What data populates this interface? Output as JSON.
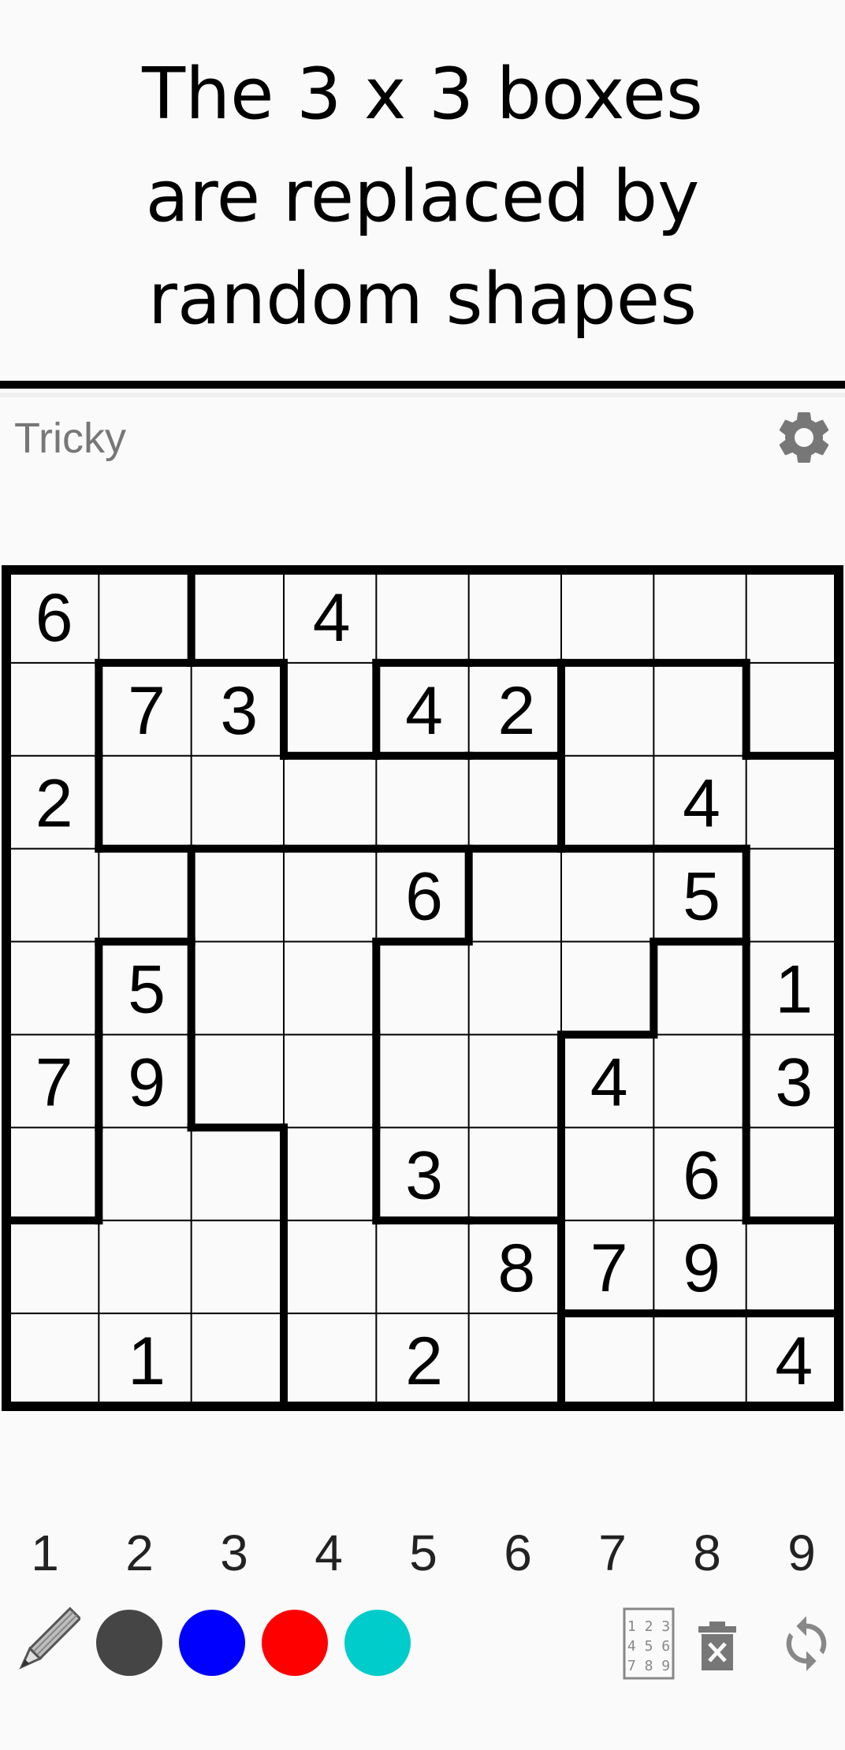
{
  "banner": {
    "lines": [
      "The 3 x 3 boxes",
      "are replaced by",
      "random shapes"
    ]
  },
  "header": {
    "difficulty": "Tricky",
    "settings_icon": "gear-icon"
  },
  "board": {
    "size": 9,
    "givens": [
      [
        "6",
        "",
        "",
        "4",
        "",
        "",
        "",
        "",
        ""
      ],
      [
        "",
        "7",
        "3",
        "",
        "4",
        "2",
        "",
        "",
        ""
      ],
      [
        "2",
        "",
        "",
        "",
        "",
        "",
        "",
        "4",
        ""
      ],
      [
        "",
        "",
        "",
        "",
        "6",
        "",
        "",
        "5",
        ""
      ],
      [
        "",
        "5",
        "",
        "",
        "",
        "",
        "",
        "",
        "1"
      ],
      [
        "7",
        "9",
        "",
        "",
        "",
        "",
        "4",
        "",
        "3"
      ],
      [
        "",
        "",
        "",
        "",
        "3",
        "",
        "",
        "6",
        ""
      ],
      [
        "",
        "",
        "",
        "",
        "",
        "8",
        "7",
        "9",
        ""
      ],
      [
        "",
        "1",
        "",
        "",
        "2",
        "",
        "",
        "",
        "4"
      ]
    ],
    "regions": [
      [
        0,
        0,
        1,
        1,
        1,
        1,
        1,
        1,
        1
      ],
      [
        0,
        2,
        2,
        1,
        3,
        3,
        4,
        4,
        1
      ],
      [
        0,
        2,
        2,
        2,
        2,
        2,
        4,
        4,
        4
      ],
      [
        0,
        0,
        5,
        5,
        5,
        6,
        6,
        6,
        4
      ],
      [
        0,
        7,
        5,
        5,
        6,
        6,
        6,
        8,
        4
      ],
      [
        0,
        7,
        5,
        5,
        6,
        6,
        8,
        8,
        4
      ],
      [
        0,
        7,
        7,
        5,
        6,
        6,
        8,
        8,
        4
      ],
      [
        7,
        7,
        7,
        5,
        5,
        5,
        8,
        8,
        8
      ],
      [
        7,
        7,
        7,
        5,
        5,
        5,
        4,
        4,
        4
      ]
    ]
  },
  "numpad": [
    "1",
    "2",
    "3",
    "4",
    "5",
    "6",
    "7",
    "8",
    "9"
  ],
  "toolbar": {
    "pencil_icon": "pencil-icon",
    "colors": [
      "#454545",
      "#0000ff",
      "#ff0000",
      "#00cccc"
    ],
    "notes_grid_icon": "notes-grid-icon",
    "notes_grid_digits": [
      "1 2 3",
      "4 5 6",
      "7 8 9"
    ],
    "erase_icon": "trash-icon",
    "reset_icon": "refresh-icon"
  }
}
